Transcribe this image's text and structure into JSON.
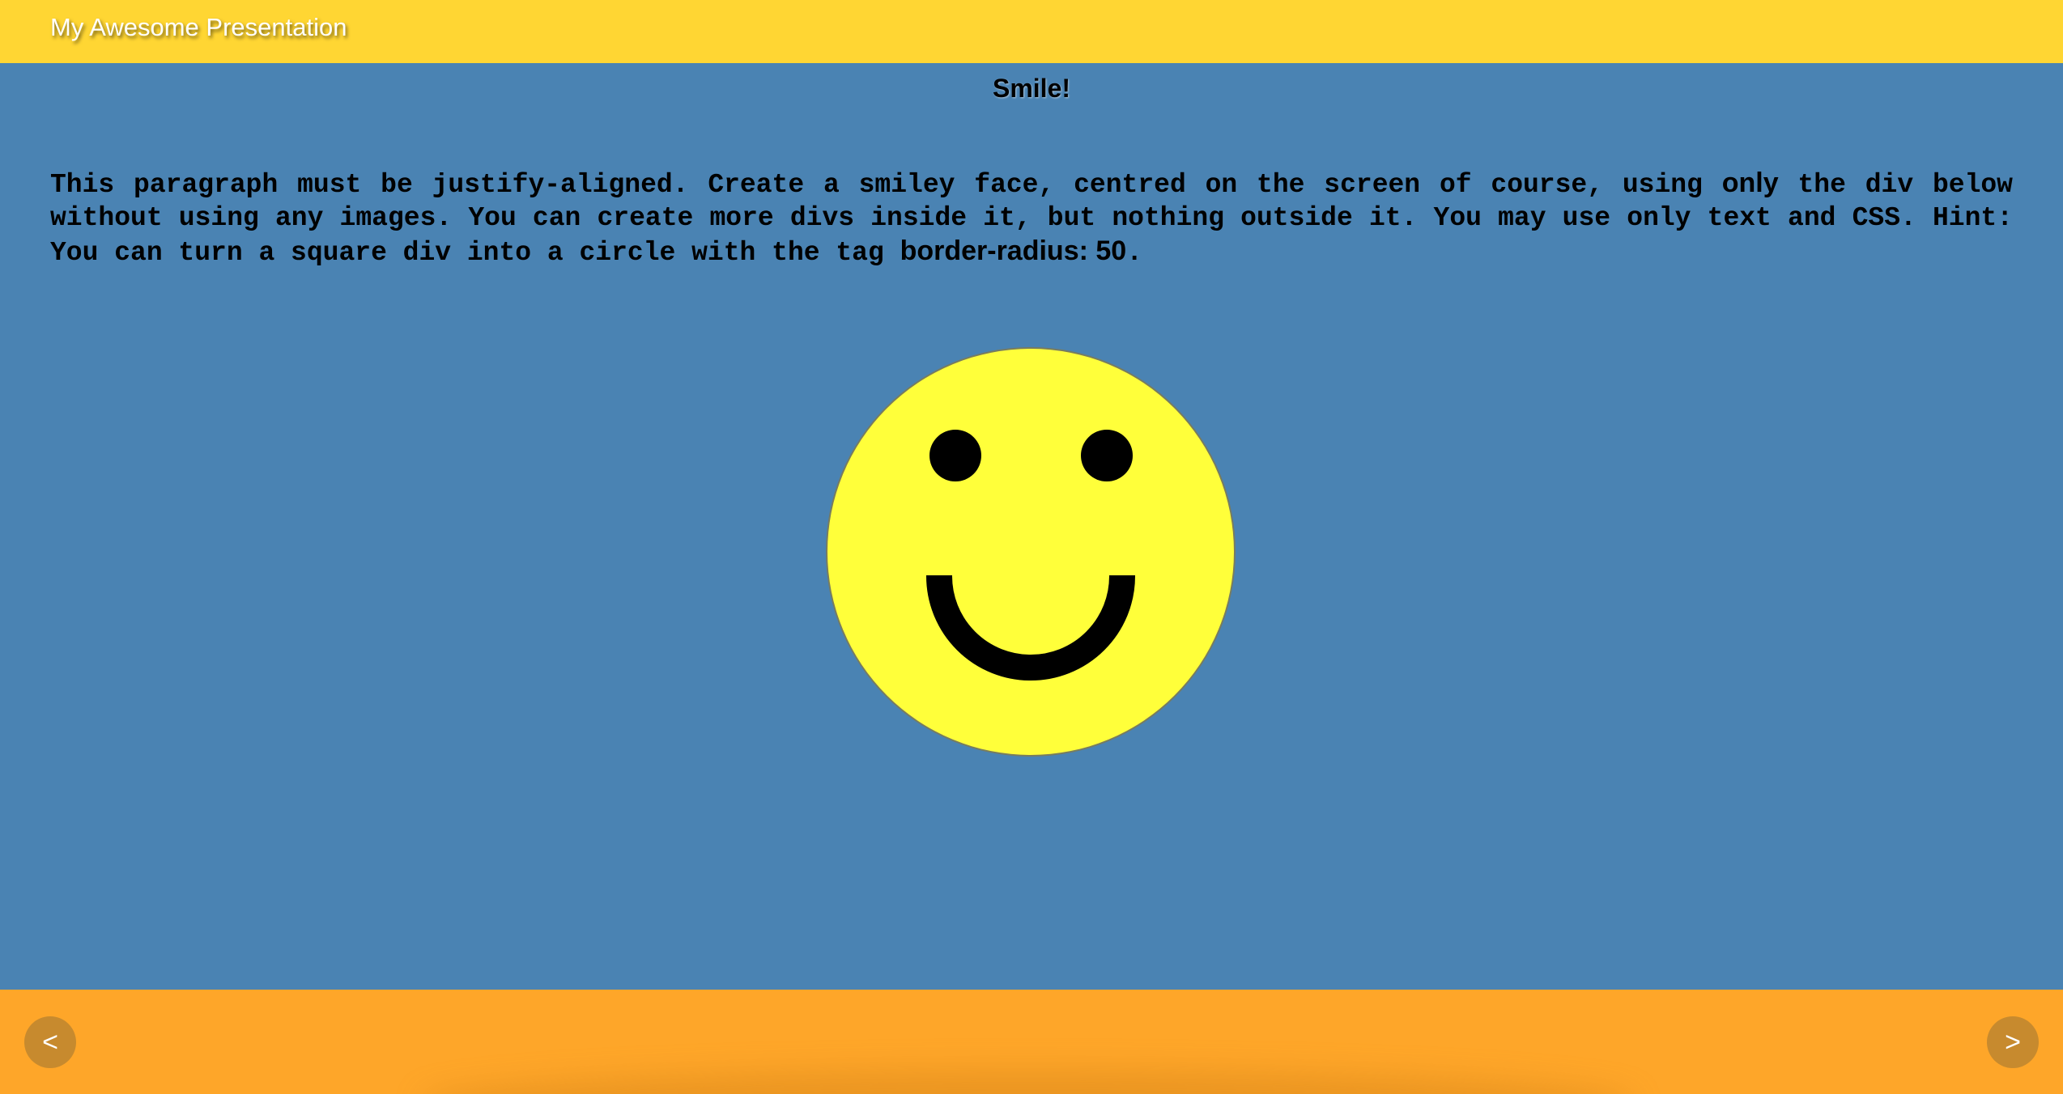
{
  "header": {
    "title": "My Awesome Presentation"
  },
  "slide": {
    "heading": "Smile!",
    "paragraph": {
      "part1": "This paragraph must be justify-aligned. Create a smiley face, centred on the screen of course, using ",
      "emphasis1": "only",
      "part2": " the div below without using any images. You can create more divs inside it, but nothing outside it. You may use only text and CSS. Hint: You can turn a square div into a circle with the tag ",
      "emphasis2": "border-radius: 50",
      "part3": "."
    },
    "smiley": {
      "face_color": "#ffff3a",
      "feature_color": "#000000"
    }
  },
  "footer": {
    "prev_label": "<",
    "next_label": ">"
  },
  "colors": {
    "topbar": "#ffd633",
    "background": "#4a83b3",
    "footer": "#fea629",
    "nav_button": "#c78a2e"
  }
}
